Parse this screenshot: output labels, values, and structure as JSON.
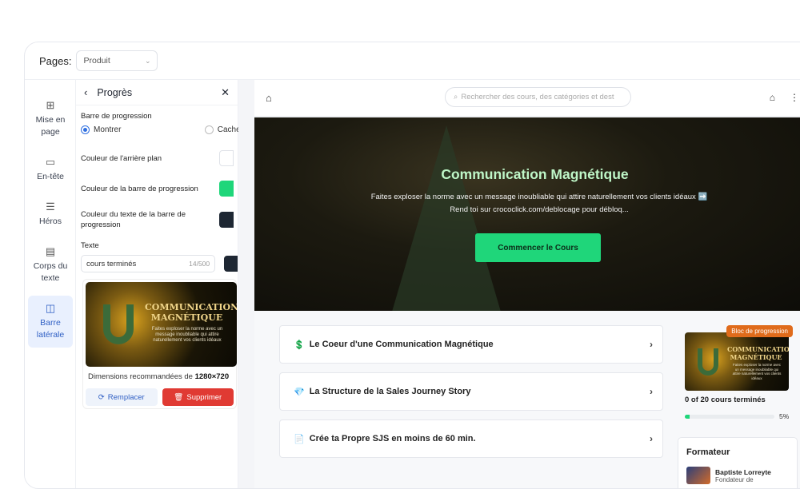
{
  "topbar": {
    "pages_label": "Pages:",
    "pages_value": "Produit"
  },
  "nav": [
    {
      "label": "Mise en page",
      "icon": "layout-icon"
    },
    {
      "label": "En-tête",
      "icon": "header-icon"
    },
    {
      "label": "Héros",
      "icon": "hero-icon"
    },
    {
      "label": "Corps du texte",
      "icon": "body-text-icon"
    },
    {
      "label": "Barre latérale",
      "icon": "sidebar-icon",
      "active": true
    }
  ],
  "panel": {
    "title": "Progrès",
    "progress_section": "Barre de progression",
    "show_label": "Montrer",
    "hide_label": "Cacher",
    "bg_color_label": "Couleur de l'arrière plan",
    "bar_color_label": "Couleur de la barre de progression",
    "bar_text_color_label": "Couleur du texte de la barre de progression",
    "text_label": "Texte",
    "text_value": "cours terminés",
    "text_count": "14/500",
    "thumb_title": "COMMUNICATION MAGNÉTIQUE",
    "thumb_sub": "Faites exploser la norme avec un message inoubliable qui attire naturellement vos clients idéaux",
    "dims_label": "Dimensions recommandées de",
    "dims_value": "1280×720",
    "replace_label": "Remplacer",
    "delete_label": "Supprimer",
    "colors": {
      "bg": "#ffffff",
      "bar": "#1fd67a",
      "text": "#1e2733"
    }
  },
  "preview": {
    "search_placeholder": "Rechercher des cours, des catégories et dest",
    "hero_title": "Communication Magnétique",
    "hero_desc": "Faites exploser la norme avec un message inoubliable qui attire naturellement vos clients idéaux ➡️ Rend toi sur crococlick.com/deblocage pour débloq...",
    "cta_label": "Commencer le Cours",
    "lessons": [
      {
        "emoji": "💲",
        "title": "Le Coeur d'une Communication Magnétique"
      },
      {
        "emoji": "💎",
        "title": "La Structure de la Sales Journey Story"
      },
      {
        "emoji": "📄",
        "title": "Crée ta Propre SJS en moins de 60 min."
      }
    ],
    "badge": "Bloc de progression",
    "progress_text": "0 of 20 cours terminés",
    "progress_percent": "5%",
    "progress_fraction": 0.05,
    "formateur_title": "Formateur",
    "formateur_name": "Baptiste Lorreyte",
    "formateur_role": "Fondateur de"
  }
}
